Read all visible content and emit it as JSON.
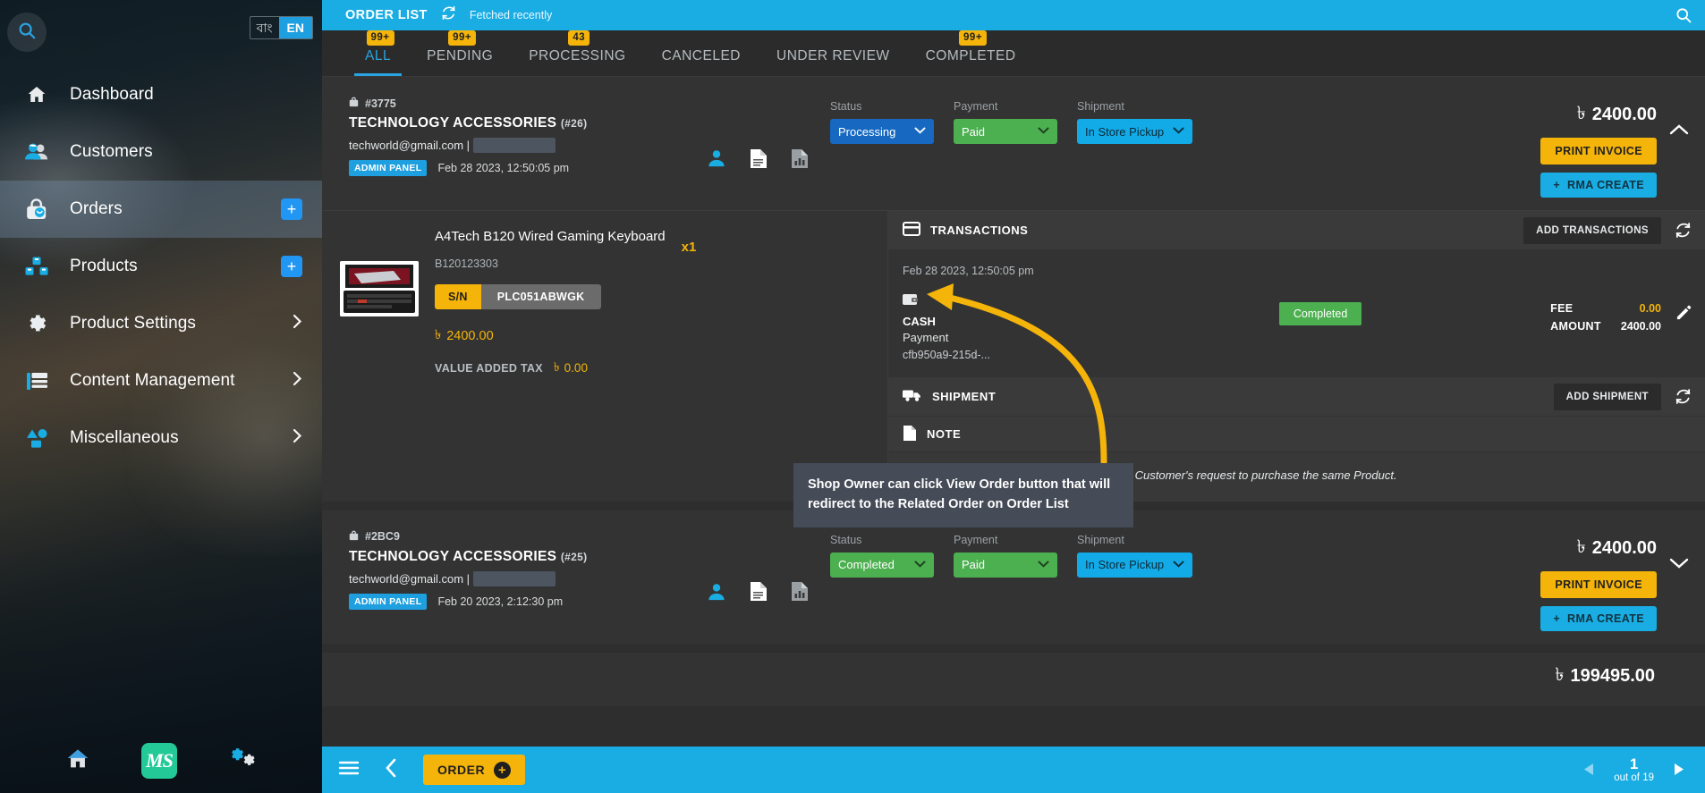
{
  "sidebar": {
    "search_icon": "search-icon",
    "language": {
      "options": [
        "বাং",
        "EN"
      ],
      "selected": "EN"
    },
    "items": [
      {
        "label": "Dashboard",
        "icon": "home-icon",
        "active": false,
        "plus": false,
        "chevron": false
      },
      {
        "label": "Customers",
        "icon": "users-icon",
        "active": false,
        "plus": false,
        "chevron": false
      },
      {
        "label": "Orders",
        "icon": "bag-icon",
        "active": true,
        "plus": true,
        "chevron": false
      },
      {
        "label": "Products",
        "icon": "boxes-icon",
        "active": false,
        "plus": true,
        "chevron": false
      },
      {
        "label": "Product Settings",
        "icon": "gear-icon",
        "active": false,
        "plus": false,
        "chevron": true
      },
      {
        "label": "Content Management",
        "icon": "layout-icon",
        "active": false,
        "plus": false,
        "chevron": true
      },
      {
        "label": "Miscellaneous",
        "icon": "shapes-icon",
        "active": false,
        "plus": false,
        "chevron": true
      }
    ],
    "footer": {
      "home_icon": "home-icon",
      "brand": "MS",
      "settings_icon": "gears-icon"
    }
  },
  "topbar": {
    "title": "ORDER LIST",
    "refresh_icon": "refresh-icon",
    "status": "Fetched recently",
    "search_icon": "search-icon"
  },
  "tabs": [
    {
      "label": "ALL",
      "badge": "99+",
      "active": true
    },
    {
      "label": "PENDING",
      "badge": "99+",
      "active": false
    },
    {
      "label": "PROCESSING",
      "badge": "43",
      "active": false
    },
    {
      "label": "CANCELED",
      "badge": "",
      "active": false
    },
    {
      "label": "UNDER REVIEW",
      "badge": "",
      "active": false
    },
    {
      "label": "COMPLETED",
      "badge": "99+",
      "active": false
    }
  ],
  "currency_symbol": "৳",
  "order1": {
    "id": "#3775",
    "title": "TECHNOLOGY ACCESSORIES",
    "title_sub": "(#26)",
    "email": "techworld@gmail.com |",
    "channel_badge": "ADMIN PANEL",
    "date": "Feb 28 2023, 12:50:05 pm",
    "icons": [
      "customer-icon",
      "document-icon",
      "report-icon"
    ],
    "status": {
      "label": "Status",
      "value": "Processing"
    },
    "payment": {
      "label": "Payment",
      "value": "Paid"
    },
    "shipment": {
      "label": "Shipment",
      "value": "In Store Pickup"
    },
    "total": "2400.00",
    "print_invoice": "PRINT INVOICE",
    "rma_create": "RMA CREATE",
    "collapse_icon": "chevron-up-icon",
    "product": {
      "name": "A4Tech B120 Wired Gaming Keyboard",
      "sku": "B120123303",
      "qty": "x1",
      "sn_label": "S/N",
      "sn_value": "PLC051ABWGK",
      "price": "2400.00",
      "vat_label": "VALUE ADDED TAX",
      "vat_value": "0.00"
    },
    "transactions": {
      "title": "TRANSACTIONS",
      "icon": "card-icon",
      "add_button": "ADD TRANSACTIONS",
      "refresh_icon": "refresh-icon",
      "row": {
        "date": "Feb 28 2023, 12:50:05 pm",
        "wallet_icon": "wallet-icon",
        "method": "CASH",
        "type": "Payment",
        "reference": "cfb950a9-215d-...",
        "state": "Completed",
        "fee_label": "FEE",
        "fee_value": "0.00",
        "amount_label": "AMOUNT",
        "amount_value": "2400.00",
        "edit_icon": "pencil-icon"
      }
    },
    "shipment_panel": {
      "title": "SHIPMENT",
      "icon": "truck-icon",
      "add_button": "ADD SHIPMENT",
      "refresh_icon": "refresh-icon"
    },
    "note_panel": {
      "title": "NOTE",
      "icon": "note-icon",
      "text": "Creating Related Order for the RMA case on Customer's request to purchase the same Product."
    }
  },
  "callout": {
    "text": "Shop Owner can click View Order button that will redirect to the Related Order on Order List",
    "arrow_color": "#f5b40a"
  },
  "order2": {
    "id": "#2BC9",
    "title": "TECHNOLOGY ACCESSORIES",
    "title_sub": "(#25)",
    "email": "techworld@gmail.com |",
    "channel_badge": "ADMIN PANEL",
    "date": "Feb 20 2023, 2:12:30 pm",
    "status": {
      "label": "Status",
      "value": "Completed"
    },
    "payment": {
      "label": "Payment",
      "value": "Paid"
    },
    "shipment": {
      "label": "Shipment",
      "value": "In Store Pickup"
    },
    "total": "2400.00",
    "print_invoice": "PRINT INVOICE",
    "rma_create": "RMA CREATE",
    "collapse_icon": "chevron-down-icon"
  },
  "order3": {
    "total": "199495.00"
  },
  "bottombar": {
    "menu_icon": "hamburger-icon",
    "back_icon": "chevron-left-icon",
    "order_button": "ORDER",
    "prev_icon": "triangle-left-icon",
    "next_icon": "triangle-right-icon",
    "page": "1",
    "page_of": "out of 19"
  }
}
